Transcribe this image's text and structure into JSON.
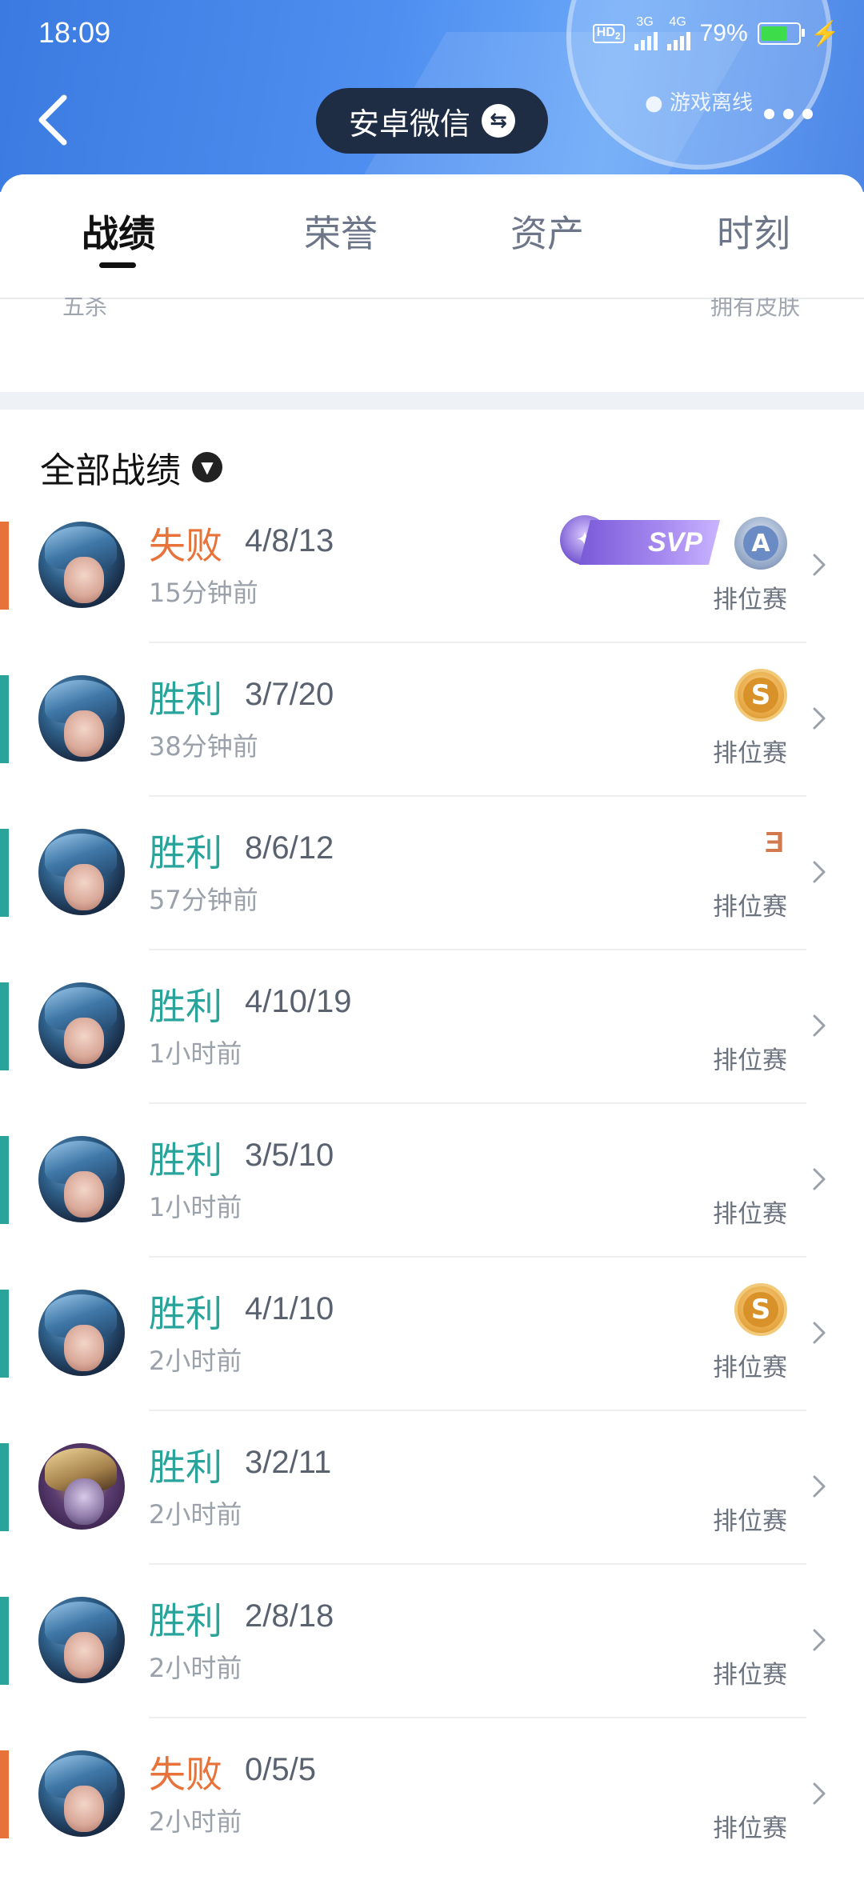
{
  "status_bar": {
    "time": "18:09",
    "hd": "HD",
    "hd_sub": "2",
    "net1": "3G",
    "net2": "4G",
    "battery": "79%",
    "battery_level": 0.79
  },
  "header": {
    "account_switch_label": "安卓微信",
    "offline_status": "游戏离线"
  },
  "tabs": [
    {
      "label": "战绩",
      "active": true
    },
    {
      "label": "荣誉",
      "active": false
    },
    {
      "label": "资产",
      "active": false
    },
    {
      "label": "时刻",
      "active": false
    }
  ],
  "peek": {
    "left": "五杀",
    "right": "拥有皮肤"
  },
  "section": {
    "title": "全部战绩"
  },
  "colors": {
    "win": "#2aa39a",
    "lose": "#e8733a",
    "header_blue": "#4f8ff0"
  },
  "matches": [
    {
      "result": "失败",
      "outcome": "lose",
      "kda": "4/8/13",
      "time": "15分钟前",
      "mode": "排位赛",
      "badges": [
        "svp",
        "a-grade"
      ],
      "svp_label": "SVP",
      "grade": "A"
    },
    {
      "result": "胜利",
      "outcome": "win",
      "kda": "3/7/20",
      "time": "38分钟前",
      "mode": "排位赛",
      "badges": [
        "s-grade"
      ],
      "grade": "S"
    },
    {
      "result": "胜利",
      "outcome": "win",
      "kda": "8/6/12",
      "time": "57分钟前",
      "mode": "排位赛",
      "badges": [
        "triple-kill"
      ],
      "mark": "3"
    },
    {
      "result": "胜利",
      "outcome": "win",
      "kda": "4/10/19",
      "time": "1小时前",
      "mode": "排位赛",
      "badges": []
    },
    {
      "result": "胜利",
      "outcome": "win",
      "kda": "3/5/10",
      "time": "1小时前",
      "mode": "排位赛",
      "badges": []
    },
    {
      "result": "胜利",
      "outcome": "win",
      "kda": "4/1/10",
      "time": "2小时前",
      "mode": "排位赛",
      "badges": [
        "s-grade"
      ],
      "grade": "S"
    },
    {
      "result": "胜利",
      "outcome": "win",
      "kda": "3/2/11",
      "time": "2小时前",
      "mode": "排位赛",
      "badges": [],
      "avatar": "alt"
    },
    {
      "result": "胜利",
      "outcome": "win",
      "kda": "2/8/18",
      "time": "2小时前",
      "mode": "排位赛",
      "badges": []
    },
    {
      "result": "失败",
      "outcome": "lose",
      "kda": "0/5/5",
      "time": "2小时前",
      "mode": "排位赛",
      "badges": []
    }
  ]
}
